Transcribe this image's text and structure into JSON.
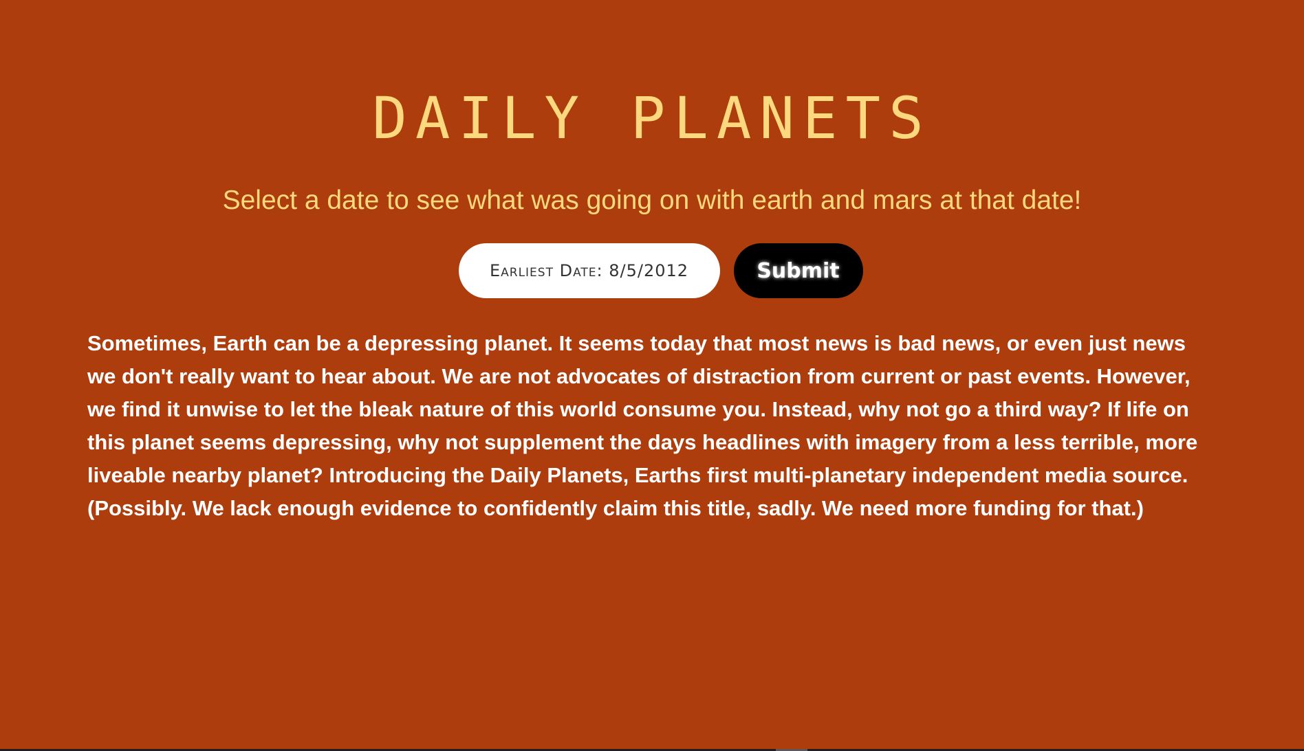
{
  "header": {
    "title": "DAILY PLANETS",
    "subtitle": "Select a date to see what was going on with earth and mars at that date!"
  },
  "form": {
    "date_placeholder": "Earliest Date: 8/5/2012",
    "date_value": "",
    "submit_label": "Submit"
  },
  "main": {
    "intro_text": "Sometimes, Earth can be a depressing planet. It seems today that most news is bad news, or even just news we don't really want to hear about. We are not advocates of distraction from current or past events. However, we find it unwise to let the bleak nature of this world consume you. Instead, why not go a third way? If life on this planet seems depressing, why not supplement the days headlines with imagery from a less terrible, more liveable nearby planet? Introducing the Daily Planets, Earths first multi-planetary independent media source. (Possibly. We lack enough evidence to confidently claim this title, sadly. We need more funding for that.)"
  },
  "colors": {
    "background": "#ad3d0c",
    "accent": "#fcd97e",
    "text": "#ffffff",
    "button": "#000000"
  }
}
